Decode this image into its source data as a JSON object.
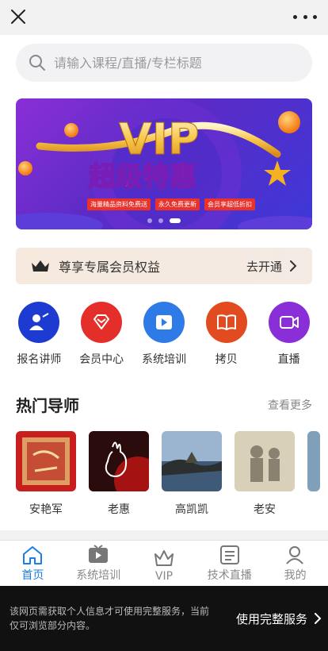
{
  "search": {
    "placeholder": "请输入课程/直播/专栏标题"
  },
  "banner": {
    "headline": "VIP",
    "subheadline": "超级特惠",
    "tags": [
      "海量精品资料免费送",
      "永久免费更新",
      "会员享超低折扣"
    ],
    "page_count": 3,
    "active_page": 3
  },
  "vip_bar": {
    "label": "尊享专属会员权益",
    "action": "去开通"
  },
  "quick_menu": [
    {
      "label": "报名讲师",
      "icon": "lecturer-icon",
      "color": "#1e3bd1"
    },
    {
      "label": "会员中心",
      "icon": "diamond-icon",
      "color": "#e42e2a"
    },
    {
      "label": "系统培训",
      "icon": "play-icon",
      "color": "#2e7be8"
    },
    {
      "label": "拷贝",
      "icon": "book-icon",
      "color": "#e24b20"
    },
    {
      "label": "直播",
      "icon": "video-camera-icon",
      "color": "#8a2ed8"
    }
  ],
  "hot_mentors": {
    "title": "热门导师",
    "more": "查看更多",
    "items": [
      {
        "name": "安艳军"
      },
      {
        "name": "老惠"
      },
      {
        "name": "高凯凯"
      },
      {
        "name": "老安"
      }
    ]
  },
  "tabbar": [
    {
      "label": "首页",
      "icon": "home-icon",
      "active": true
    },
    {
      "label": "系统培训",
      "icon": "tv-play-icon",
      "active": false
    },
    {
      "label": "VIP",
      "icon": "crown-icon",
      "active": false
    },
    {
      "label": "技术直播",
      "icon": "live-screen-icon",
      "active": false
    },
    {
      "label": "我的",
      "icon": "user-icon",
      "active": false
    }
  ],
  "notice": {
    "text": "该网页需获取个人信息才可使用完整服务，当前仅可浏览部分内容。",
    "action": "使用完整服务"
  },
  "colors": {
    "accent": "#1a7ee8",
    "brand_purple": "#5b2bc6"
  }
}
